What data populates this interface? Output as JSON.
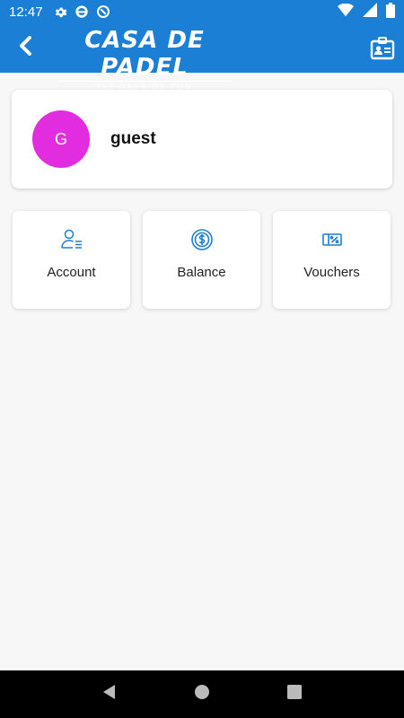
{
  "status_bar": {
    "time": "12:47",
    "icons": [
      "gear-icon",
      "app-notification-icon",
      "do-not-disturb-icon"
    ],
    "right_icons": [
      "wifi-icon",
      "signal-icon",
      "battery-icon"
    ]
  },
  "app_bar": {
    "brand_title": "CASA DE PADEL",
    "brand_subtitle": "365 DAYS OF FUN",
    "back_icon": "chevron-left-icon",
    "action_icon": "id-card-icon",
    "color": "#1c7fd6"
  },
  "profile": {
    "avatar_initial": "G",
    "avatar_color": "#e22ce0",
    "name": "guest"
  },
  "tiles": [
    {
      "label": "Account",
      "icon": "user-list-icon"
    },
    {
      "label": "Balance",
      "icon": "dollar-coin-icon"
    },
    {
      "label": "Vouchers",
      "icon": "voucher-icon"
    }
  ],
  "nav": {
    "icons": [
      "back-triangle-icon",
      "home-circle-icon",
      "recents-square-icon"
    ]
  }
}
